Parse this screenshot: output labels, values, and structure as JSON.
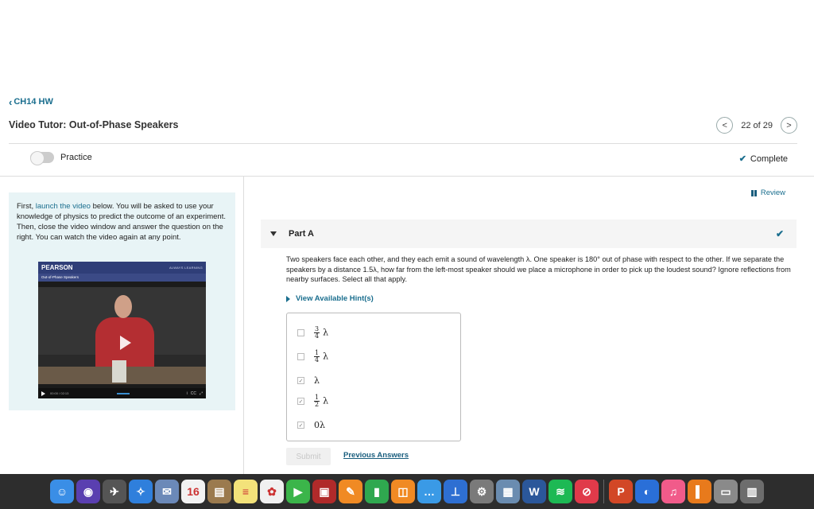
{
  "nav": {
    "back_label": "CH14 HW",
    "title": "Video Tutor: Out-of-Phase Speakers",
    "pager_text": "22 of 29"
  },
  "toolbar": {
    "practice_label": "Practice",
    "complete_label": "Complete"
  },
  "left": {
    "intro_1": "First, ",
    "intro_link": "launch the video",
    "intro_2": " below. You will be asked to use your knowledge of physics to predict the outcome of an experiment. Then, close the video window and answer the question on the right. You can watch the video again at any point.",
    "video_brand": "PEARSON",
    "video_tagline": "ALWAYS LEARNING",
    "video_subtitle": "Out-of-Phase Speakers",
    "video_time": "00:00 / 02:13",
    "video_cc": "CC"
  },
  "main": {
    "review_label": "Review",
    "part_label": "Part A",
    "question": "Two speakers face each other, and they each emit a sound of wavelength λ. One speaker is 180° out of phase with respect to the other. If we separate the speakers by a distance 1.5λ, how far from the left-most speaker should we place a microphone in order to pick up the loudest sound? Ignore reflections from nearby surfaces. Select all that apply.",
    "hints_label": "View Available Hint(s)",
    "options": [
      {
        "num": "3",
        "den": "4",
        "sym": "λ",
        "checked": false
      },
      {
        "num": "1",
        "den": "4",
        "sym": "λ",
        "checked": false
      },
      {
        "label": "λ",
        "checked": true
      },
      {
        "num": "1",
        "den": "2",
        "sym": "λ",
        "checked": true
      },
      {
        "label": "0λ",
        "checked": true
      }
    ],
    "submit_label": "Submit",
    "prev_label": "Previous Answers"
  },
  "dock": [
    {
      "name": "finder-icon",
      "color": "#3a8ee6",
      "glyph": "☺"
    },
    {
      "name": "siri-icon",
      "color": "#5a3fb0",
      "glyph": "◉"
    },
    {
      "name": "launchpad-icon",
      "color": "#555555",
      "glyph": "✈"
    },
    {
      "name": "safari-icon",
      "color": "#2f7fdc",
      "glyph": "✧"
    },
    {
      "name": "mail-icon",
      "color": "#6b89b8",
      "glyph": "✉"
    },
    {
      "name": "calendar-icon",
      "color": "#f2f2f2",
      "glyph": "16"
    },
    {
      "name": "contacts-icon",
      "color": "#9b7a4e",
      "glyph": "▤"
    },
    {
      "name": "notes-icon",
      "color": "#f3e27a",
      "glyph": "≡"
    },
    {
      "name": "photos-icon",
      "color": "#f0f0f0",
      "glyph": "✿"
    },
    {
      "name": "facetime-icon",
      "color": "#3bb54a",
      "glyph": "▶"
    },
    {
      "name": "photo-booth-icon",
      "color": "#b02a2a",
      "glyph": "▣"
    },
    {
      "name": "pages-icon",
      "color": "#f08a24",
      "glyph": "✎"
    },
    {
      "name": "numbers-icon",
      "color": "#2fa84f",
      "glyph": "▮"
    },
    {
      "name": "ibooks-icon",
      "color": "#f08a24",
      "glyph": "◫"
    },
    {
      "name": "messages-icon",
      "color": "#3a9ae6",
      "glyph": "…"
    },
    {
      "name": "keynote-icon",
      "color": "#2e6fd2",
      "glyph": "⊥"
    },
    {
      "name": "system-preferences-icon",
      "color": "#7a7a7a",
      "glyph": "⚙"
    },
    {
      "name": "preview-icon",
      "color": "#6a8cb0",
      "glyph": "▦"
    },
    {
      "name": "word-icon",
      "color": "#2b579a",
      "glyph": "W"
    },
    {
      "name": "spotify-icon",
      "color": "#1db954",
      "glyph": "≋"
    },
    {
      "name": "no-entry-icon",
      "color": "#e03a4a",
      "glyph": "⊘"
    },
    {
      "name": "powerpoint-icon",
      "color": "#d24726",
      "glyph": "P"
    },
    {
      "name": "browser-icon",
      "color": "#2a6fd8",
      "glyph": "◐"
    },
    {
      "name": "itunes-icon",
      "color": "#f15b8a",
      "glyph": "♫"
    },
    {
      "name": "bookmarks-icon",
      "color": "#e87a1c",
      "glyph": "▌"
    },
    {
      "name": "disk-utility-icon",
      "color": "#8a8a8a",
      "glyph": "▭"
    },
    {
      "name": "trash-icon",
      "color": "#6d6d6d",
      "glyph": "▥"
    }
  ]
}
